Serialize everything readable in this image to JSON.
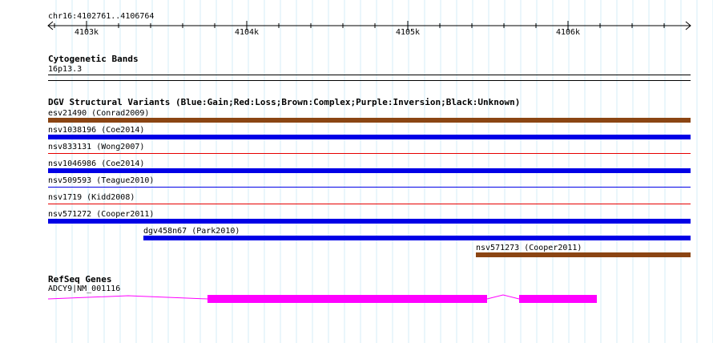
{
  "ruler": {
    "position_label": "chr16:4102761..4106764",
    "ticks": [
      {
        "label": "4103k",
        "pos": 4103000
      },
      {
        "label": "4104k",
        "pos": 4104000
      },
      {
        "label": "4105k",
        "pos": 4105000
      },
      {
        "label": "4106k",
        "pos": 4106000
      }
    ]
  },
  "cytobands": {
    "title": "Cytogenetic Bands",
    "band_label": "16p13.3"
  },
  "dgv": {
    "title": "DGV Structural Variants (Blue:Gain;Red:Loss;Brown:Complex;Purple:Inversion;Black:Unknown)",
    "colors": {
      "gain": "#0000e6",
      "loss": "#e60000",
      "complex": "#8b4513",
      "inversion": "#800080",
      "unknown": "#000000"
    },
    "variants": [
      {
        "label": "esv21490 (Conrad2009)",
        "type": "complex",
        "thick": true,
        "start": 4102761,
        "end": 4106764
      },
      {
        "label": "nsv1038196 (Coe2014)",
        "type": "gain",
        "thick": true,
        "start": 4102761,
        "end": 4106764
      },
      {
        "label": "nsv833131 (Wong2007)",
        "type": "loss",
        "thick": false,
        "start": 4102761,
        "end": 4106764
      },
      {
        "label": "nsv1046986 (Coe2014)",
        "type": "gain",
        "thick": true,
        "start": 4102761,
        "end": 4106764
      },
      {
        "label": "nsv509593 (Teague2010)",
        "type": "gain",
        "thick": false,
        "start": 4102761,
        "end": 4106764
      },
      {
        "label": "nsv1719 (Kidd2008)",
        "type": "loss",
        "thick": false,
        "start": 4102761,
        "end": 4106764
      },
      {
        "label": "nsv571272 (Cooper2011)",
        "type": "gain",
        "thick": true,
        "start": 4102761,
        "end": 4106764
      },
      {
        "label": "dgv458n67 (Park2010)",
        "type": "gain",
        "thick": true,
        "start": 4103355,
        "end": 4106764
      },
      {
        "label": "nsv571273 (Cooper2011)",
        "type": "complex",
        "thick": true,
        "start": 4105425,
        "end": 4106764
      }
    ]
  },
  "refseq": {
    "title": "RefSeq Genes",
    "gene_label": "ADCY9|NM_001116",
    "color": "#ff00ff",
    "transcript": {
      "start": 4102761,
      "end": 4106179
    },
    "exons": [
      {
        "start": 4103755,
        "end": 4105495
      },
      {
        "start": 4105695,
        "end": 4106179
      }
    ]
  }
}
